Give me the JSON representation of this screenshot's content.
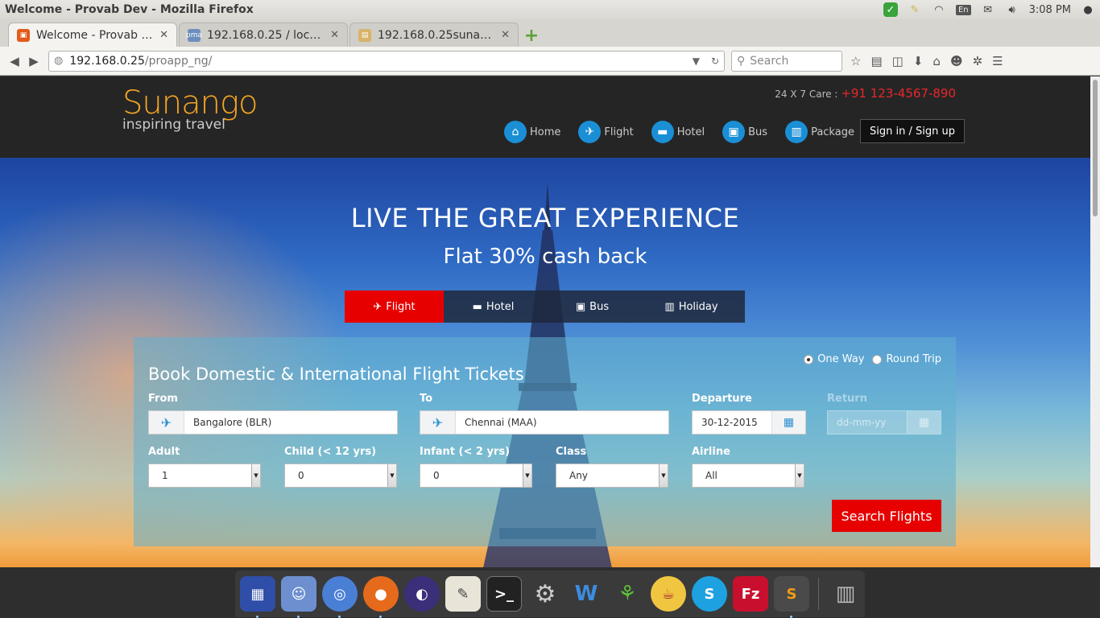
{
  "os": {
    "window_title": "Welcome - Provab Dev - Mozilla Firefox",
    "lang": "En",
    "clock": "3:08 PM"
  },
  "browser": {
    "tabs": [
      {
        "title": "Welcome - Provab Dev",
        "active": true,
        "favicon_color": "#e25b1a"
      },
      {
        "title": "192.168.0.25 / localh…",
        "active": false,
        "favicon_color": "#6c8ebf"
      },
      {
        "title": "192.168.0.25sunang…",
        "active": false,
        "favicon_color": "#d8b36a"
      }
    ],
    "url_host": "192.168.0.25",
    "url_path": "/proapp_ng/",
    "search_placeholder": "Search"
  },
  "site": {
    "logo_name": "Sunango",
    "logo_tagline": "inspiring travel",
    "care_label": "24 X 7 Care :",
    "care_phone": "+91 123-4567-890",
    "menu": [
      {
        "label": "Home",
        "icon": "home-icon"
      },
      {
        "label": "Flight",
        "icon": "plane-icon"
      },
      {
        "label": "Hotel",
        "icon": "bed-icon"
      },
      {
        "label": "Bus",
        "icon": "bus-icon"
      },
      {
        "label": "Package",
        "icon": "luggage-icon"
      }
    ],
    "signin_label": "Sign in / Sign up"
  },
  "hero": {
    "title": "LIVE THE GREAT EXPERIENCE",
    "subtitle": "Flat 30% cash back",
    "service_tabs": [
      {
        "label": "Flight",
        "active": true
      },
      {
        "label": "Hotel",
        "active": false
      },
      {
        "label": "Bus",
        "active": false
      },
      {
        "label": "Holiday",
        "active": false
      }
    ]
  },
  "form": {
    "title": "Book Domestic & International Flight Tickets",
    "trip_one_way": "One Way",
    "trip_round": "Round Trip",
    "trip_selected": "One Way",
    "from_label": "From",
    "from_value": "Bangalore (BLR)",
    "to_label": "To",
    "to_value": "Chennai (MAA)",
    "departure_label": "Departure",
    "departure_value": "30-12-2015",
    "return_label": "Return",
    "return_placeholder": "dd-mm-yy",
    "adult_label": "Adult",
    "adult_value": "1",
    "child_label": "Child (< 12 yrs)",
    "child_value": "0",
    "infant_label": "Infant (< 2 yrs)",
    "infant_value": "0",
    "class_label": "Class",
    "class_value": "Any",
    "airline_label": "Airline",
    "airline_value": "All",
    "search_button": "Search Flights"
  },
  "dock": {
    "apps": [
      "workspaces",
      "finder",
      "chromium",
      "firefox",
      "eclipse",
      "text-editor",
      "terminal",
      "settings",
      "office",
      "network",
      "teapot",
      "skype",
      "filezilla",
      "sublime-text"
    ],
    "trash": "trash"
  },
  "colors": {
    "brand_orange": "#f5a623",
    "accent_red": "#e60000",
    "nav_blue": "#1a8fd6",
    "header_dark": "#252525"
  }
}
